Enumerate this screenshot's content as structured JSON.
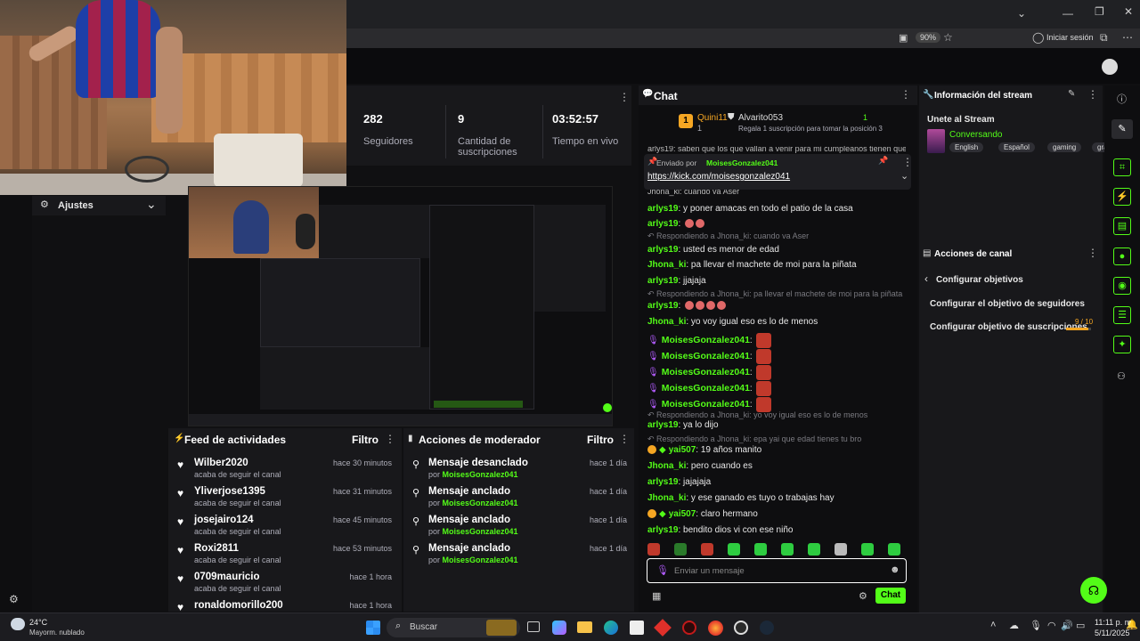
{
  "browser": {
    "zoom": "90%",
    "signin_label": "Iniciar sesión"
  },
  "stats": [
    {
      "value": "282",
      "label": "Seguidores"
    },
    {
      "value": "9",
      "label": "Cantidad de suscripciones"
    },
    {
      "value": "03:52:57",
      "label": "Tiempo en vivo"
    }
  ],
  "settings": {
    "label": "Ajustes"
  },
  "feed": {
    "title": "Feed de actividades",
    "filter": "Filtro",
    "items": [
      {
        "name": "Wilber2020",
        "action": "acaba de seguir el canal",
        "time": "hace 30 minutos"
      },
      {
        "name": "Yliverjose1395",
        "action": "acaba de seguir el canal",
        "time": "hace 31 minutos"
      },
      {
        "name": "josejairo124",
        "action": "acaba de seguir el canal",
        "time": "hace 45 minutos"
      },
      {
        "name": "Roxi2811",
        "action": "acaba de seguir el canal",
        "time": "hace 53 minutos"
      },
      {
        "name": "0709mauricio",
        "action": "acaba de seguir el canal",
        "time": "hace 1 hora"
      },
      {
        "name": "ronaldomorillo200",
        "action": "",
        "time": "hace 1 hora"
      }
    ]
  },
  "moderator": {
    "title": "Acciones de moderador",
    "filter": "Filtro",
    "items": [
      {
        "action": "Mensaje desanclado",
        "by": "por",
        "user": "MoisesGonzalez041",
        "time": "hace 1 día"
      },
      {
        "action": "Mensaje anclado",
        "by": "por",
        "user": "MoisesGonzalez041",
        "time": "hace 1 día"
      },
      {
        "action": "Mensaje anclado",
        "by": "por",
        "user": "MoisesGonzalez041",
        "time": "hace 1 día"
      },
      {
        "action": "Mensaje anclado",
        "by": "por",
        "user": "MoisesGonzalez041",
        "time": "hace 1 día"
      }
    ]
  },
  "chat": {
    "title": "Chat",
    "gifter_top": "Quini11",
    "gifter_top_count": "1",
    "gifter_second": "Alvarito053",
    "gifter_second_count": "1",
    "gift_text": "Regala 1 suscripción para tomar la posición 3",
    "pinned_by_label": "Enviado por",
    "pinned_user": "MoisesGonzalez041",
    "pinned_link": "https://kick.com/moisesgonzalez041",
    "clipped_line": "arlys19: saben que los que vallan a venir para mi cumpleanos tienen que",
    "clipped_line2": "Jhona_ki: cuando va Aser",
    "messages": [
      {
        "type": "msg",
        "user": "arlys19",
        "text": "y poner amacas en todo el patio de la casa"
      },
      {
        "type": "msg",
        "user": "arlys19",
        "text": ""
      },
      {
        "type": "reply",
        "text": "Respondiendo a Jhona_ki: cuando va Aser"
      },
      {
        "type": "msg",
        "user": "arlys19",
        "text": "usted es menor de edad"
      },
      {
        "type": "msg",
        "user": "Jhona_ki",
        "text": "pa llevar el machete de moi para la piñata"
      },
      {
        "type": "msg",
        "user": "arlys19",
        "text": "jjajaja"
      },
      {
        "type": "reply",
        "text": "Respondiendo a Jhona_ki: pa llevar el machete de moi para la piñata"
      },
      {
        "type": "msg",
        "user": "arlys19",
        "text": ""
      },
      {
        "type": "msg",
        "user": "Jhona_ki",
        "text": "yo voy igual eso es lo de menos"
      },
      {
        "type": "mod",
        "user": "MoisesGonzalez041",
        "text": ""
      },
      {
        "type": "mod",
        "user": "MoisesGonzalez041",
        "text": ""
      },
      {
        "type": "mod",
        "user": "MoisesGonzalez041",
        "text": ""
      },
      {
        "type": "mod",
        "user": "MoisesGonzalez041",
        "text": ""
      },
      {
        "type": "mod",
        "user": "MoisesGonzalez041",
        "text": ""
      },
      {
        "type": "reply",
        "text": "Respondiendo a Jhona_ki: yo voy igual eso es lo de menos"
      },
      {
        "type": "msg",
        "user": "arlys19",
        "text": "ya lo dijo"
      },
      {
        "type": "reply",
        "text": "Respondiendo a Jhona_ki: epa yai que edad tienes tu bro"
      },
      {
        "type": "sub",
        "user": "yai507",
        "text": "19 años manito"
      },
      {
        "type": "msg",
        "user": "Jhona_ki",
        "text": "pero cuando es"
      },
      {
        "type": "msg",
        "user": "arlys19",
        "text": "jajajaja"
      },
      {
        "type": "msg",
        "user": "Jhona_ki",
        "text": "y ese ganado es tuyo o trabajas hay"
      },
      {
        "type": "sub",
        "user": "yai507",
        "text": "claro hermano"
      },
      {
        "type": "msg",
        "user": "arlys19",
        "text": "bendito dios vi con ese niño"
      }
    ],
    "input_placeholder": "Enviar un mensaje",
    "send_label": "Chat"
  },
  "stream_info": {
    "title": "Información del stream",
    "stream_title": "Unete al Stream",
    "category": "Conversando",
    "tags": [
      "English",
      "Español",
      "gaming",
      "granja"
    ]
  },
  "channel_actions": {
    "title": "Acciones de canal",
    "back_label": "Configurar objetivos",
    "goal_followers": "Configurar el objetivo de seguidores",
    "goal_subs": "Configurar objetivo de suscripciones",
    "goal_subs_progress": "9 / 10",
    "goal_subs_fraction": 0.9
  },
  "taskbar": {
    "weather_temp": "24°C",
    "weather_desc": "Mayorm. nublado",
    "search_label": "Buscar",
    "time": "11:11 p. m.",
    "date": "5/11/2025"
  },
  "colors": {
    "accent": "#53fc18",
    "panel": "#18181b",
    "bg": "#0e0e10",
    "sub_badge": "#f5a623"
  }
}
